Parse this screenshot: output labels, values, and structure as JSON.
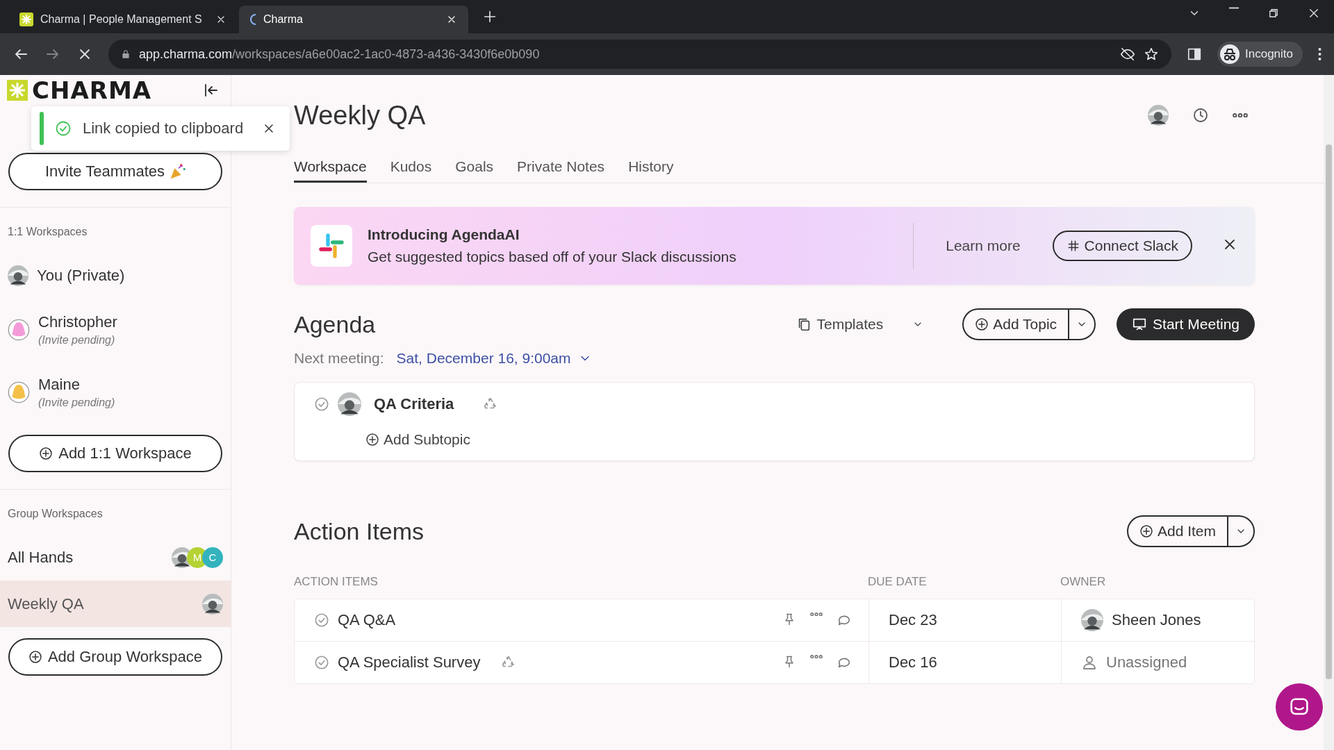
{
  "browser": {
    "tabs": [
      {
        "title": "Charma | People Management S",
        "selected": false
      },
      {
        "title": "Charma",
        "selected": true
      }
    ],
    "url_host": "app.charma.com",
    "url_path": "/workspaces/a6e00ac2-1ac0-4873-a436-3430f6e0b090",
    "profile": "Incognito"
  },
  "toast": {
    "message": "Link copied to clipboard"
  },
  "sidebar": {
    "logo": "CHARMA",
    "invite_button": "Invite Teammates",
    "sections": [
      {
        "title": "1:1 Workspaces",
        "add_button": "Add 1:1 Workspace",
        "items": [
          {
            "name": "You (Private)",
            "selected": false,
            "avatar": {
              "kind": "photo"
            }
          },
          {
            "name": "Christopher",
            "note": "(Invite pending)",
            "selected": false,
            "avatar": {
              "kind": "blob",
              "color": "#f59ad8"
            }
          },
          {
            "name": "Maine",
            "note": "(Invite pending)",
            "selected": false,
            "avatar": {
              "kind": "blob",
              "color": "#f5c04a"
            }
          }
        ]
      },
      {
        "title": "Group Workspaces",
        "add_button": "Add Group Workspace",
        "items": [
          {
            "name": "All Hands",
            "selected": false,
            "members": [
              {
                "kind": "photo"
              },
              {
                "kind": "initial",
                "initial": "M",
                "color": "#b5d334"
              },
              {
                "kind": "initial",
                "initial": "C",
                "color": "#33b3bd"
              }
            ]
          },
          {
            "name": "Weekly QA",
            "selected": true,
            "members": [
              {
                "kind": "photo"
              }
            ]
          }
        ]
      }
    ]
  },
  "page": {
    "title": "Weekly QA",
    "tabs": [
      {
        "label": "Workspace",
        "selected": true
      },
      {
        "label": "Kudos",
        "selected": false
      },
      {
        "label": "Goals",
        "selected": false
      },
      {
        "label": "Private Notes",
        "selected": false
      },
      {
        "label": "History",
        "selected": false
      }
    ],
    "banner": {
      "title": "Introducing AgendaAI",
      "text": "Get suggested topics based off of your Slack discussions",
      "link": "Learn more",
      "button": "Connect Slack"
    },
    "agenda": {
      "heading": "Agenda",
      "templates": "Templates",
      "add_topic": "Add Topic",
      "start": "Start Meeting",
      "next_label": "Next meeting:",
      "next_value": "Sat, December 16, 9:00am",
      "topics": [
        {
          "title": "QA Criteria",
          "add_subtopic": "Add Subtopic"
        }
      ]
    },
    "action_items": {
      "heading": "Action Items",
      "add_item": "Add Item",
      "columns": [
        "ACTION ITEMS",
        "DUE DATE",
        "OWNER"
      ],
      "rows": [
        {
          "title": "QA Q&A",
          "recurring": false,
          "due": "Dec 23",
          "owner": "Sheen Jones",
          "kind": "person"
        },
        {
          "title": "QA Specialist Survey",
          "recurring": true,
          "due": "Dec 16",
          "owner": "Unassigned",
          "kind": "unassigned"
        }
      ]
    }
  }
}
